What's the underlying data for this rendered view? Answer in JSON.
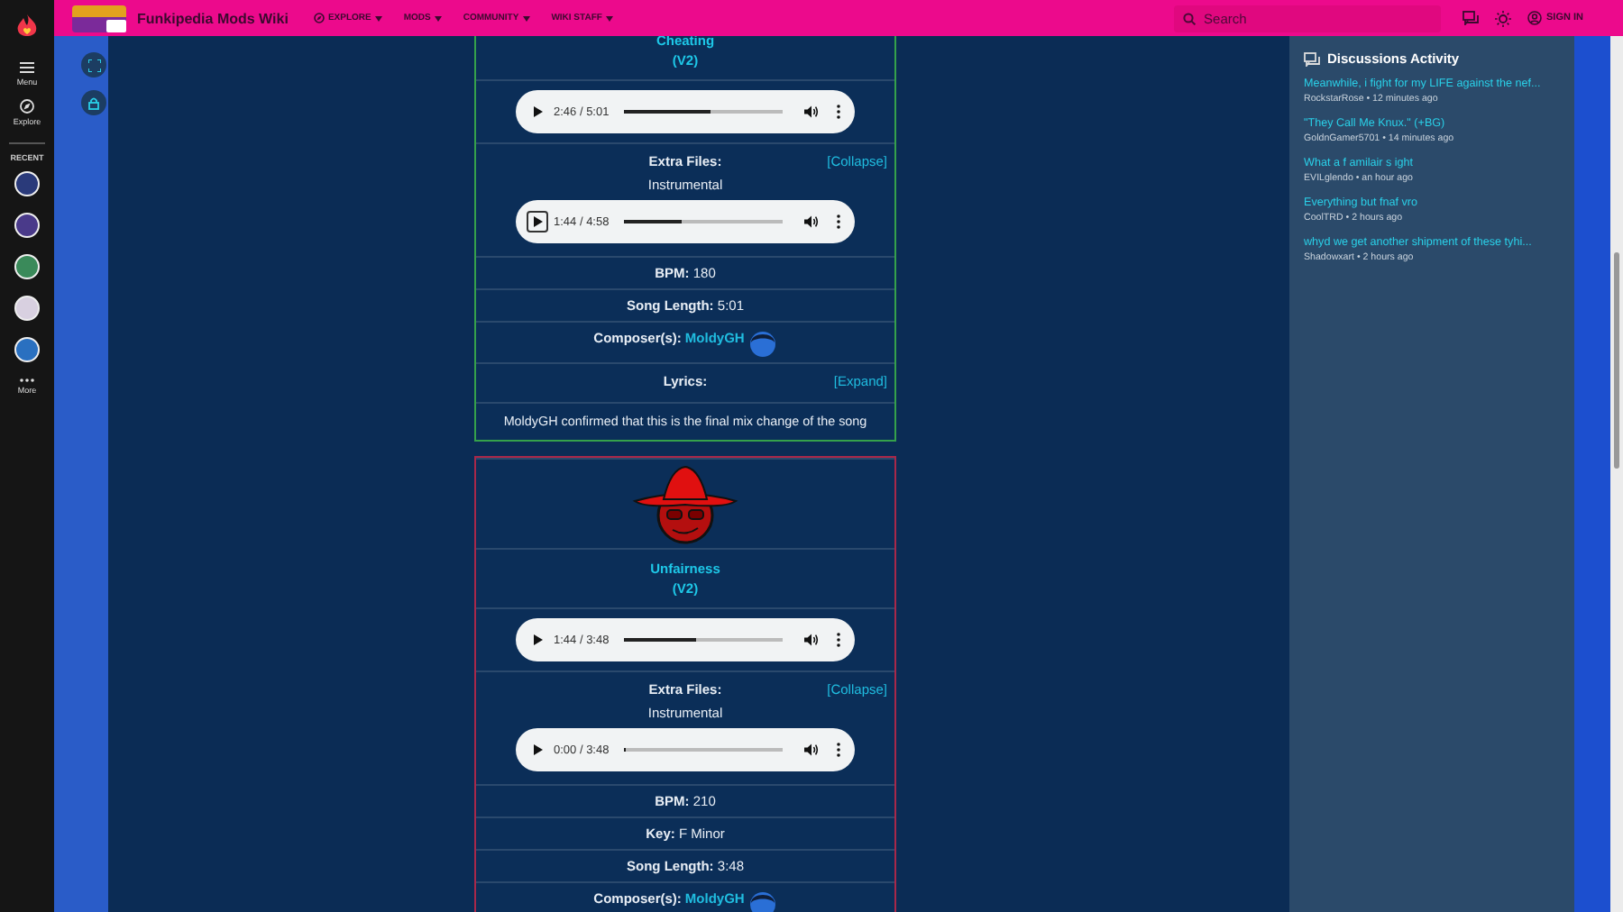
{
  "top_bar": {
    "site_title": "Funkipedia Mods Wiki",
    "nav": [
      {
        "label": "EXPLORE",
        "kind": "explore"
      },
      {
        "label": "MODS",
        "kind": "menu"
      },
      {
        "label": "COMMUNITY",
        "kind": "menu"
      },
      {
        "label": "WIKI STAFF",
        "kind": "menu"
      }
    ],
    "search": {
      "placeholder": "Search"
    },
    "sign_in": "SIGN IN"
  },
  "left_rail": {
    "items": [
      {
        "label": "Menu",
        "kind": "menu"
      },
      {
        "label": "Explore",
        "kind": "explore"
      }
    ],
    "recent_label": "RECENT",
    "more": "More"
  },
  "songs": [
    {
      "color": "#35a14b",
      "rows": [
        {
          "kind": "title",
          "title": "Cheating",
          "subtitle": "(V2)"
        },
        {
          "kind": "player",
          "time": "2:46 / 5:01",
          "level": 0.55,
          "focused": false
        },
        {
          "kind": "extra",
          "label": "Extra Files:",
          "toggle": "[Collapse]",
          "caption": "Instrumental",
          "player": {
            "time": "1:44 / 4:58",
            "level": 0.36,
            "focused": true
          }
        },
        {
          "kind": "field",
          "label": "BPM:",
          "value": "180"
        },
        {
          "kind": "field",
          "label": "Song Length:",
          "value": "5:01"
        },
        {
          "kind": "composer",
          "label": "Composer(s):",
          "value": "MoldyGH"
        },
        {
          "kind": "lyrics",
          "label": "Lyrics:",
          "toggle": "[Expand]"
        },
        {
          "kind": "text",
          "text": "MoldyGH confirmed that this is the final mix change of the song"
        }
      ]
    },
    {
      "color": "#a8284a",
      "rows": [
        {
          "kind": "image"
        },
        {
          "kind": "title",
          "title": "Unfairness",
          "subtitle": "(V2)"
        },
        {
          "kind": "player",
          "time": "1:44 / 3:48",
          "level": 0.46,
          "focused": false
        },
        {
          "kind": "extra",
          "label": "Extra Files:",
          "toggle": "[Collapse]",
          "caption": "Instrumental",
          "player": {
            "time": "0:00 / 3:48",
            "level": 0,
            "focused": false
          }
        },
        {
          "kind": "field",
          "label": "BPM:",
          "value": "210"
        },
        {
          "kind": "field",
          "label": "Key:",
          "value": "F Minor"
        },
        {
          "kind": "field",
          "label": "Song Length:",
          "value": "3:48"
        },
        {
          "kind": "composer",
          "label": "Composer(s):",
          "value": "MoldyGH"
        }
      ]
    }
  ],
  "discussions": {
    "title": "Discussions Activity",
    "items": [
      {
        "title": "Meanwhile, i fight for my LIFE against the nef...",
        "meta": "RockstarRose • 12 minutes ago"
      },
      {
        "title": "\"They Call Me Knux.\" (+BG)",
        "meta": "GoldnGamer5701 • 14 minutes ago"
      },
      {
        "title": "What a f amilair s ight",
        "meta": "EVILglendo • an hour ago"
      },
      {
        "title": "Everything but fnaf vro",
        "meta": "CoolTRD • 2 hours ago"
      },
      {
        "title": "whyd we get another shipment of these tyhi...",
        "meta": "Shadowxart • 2 hours ago"
      }
    ]
  }
}
